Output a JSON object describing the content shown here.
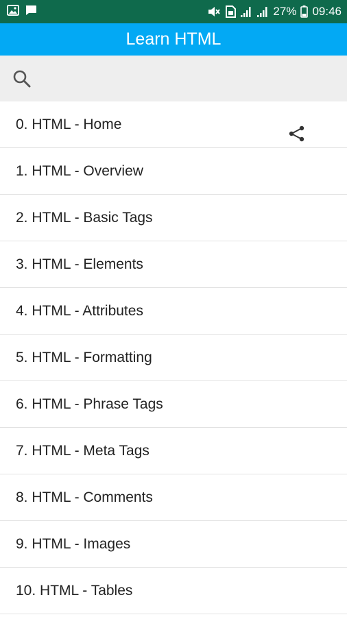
{
  "status_bar": {
    "battery_percent": "27%",
    "time": "09:46"
  },
  "app_bar": {
    "title": "Learn HTML"
  },
  "toolbar": {
    "search_icon": "search-icon",
    "share_icon": "share-icon"
  },
  "lessons": [
    {
      "label": "0. HTML - Home"
    },
    {
      "label": "1. HTML - Overview"
    },
    {
      "label": "2. HTML - Basic Tags"
    },
    {
      "label": "3. HTML - Elements"
    },
    {
      "label": "4. HTML - Attributes"
    },
    {
      "label": "5. HTML - Formatting"
    },
    {
      "label": "6. HTML - Phrase Tags"
    },
    {
      "label": "7. HTML - Meta Tags"
    },
    {
      "label": "8. HTML - Comments"
    },
    {
      "label": "9. HTML - Images"
    },
    {
      "label": "10. HTML - Tables"
    }
  ],
  "colors": {
    "status_bar": "#0f6a4c",
    "app_bar": "#03a9f4",
    "toolbar": "#eeeeee"
  }
}
